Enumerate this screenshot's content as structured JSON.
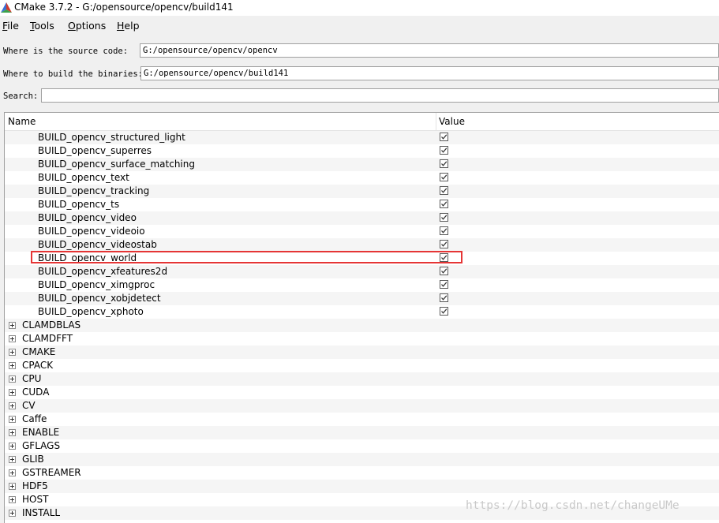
{
  "window": {
    "title": "CMake 3.7.2 - G:/opensource/opencv/build141",
    "icon": "cmake-triangle-icon"
  },
  "menubar": {
    "items": [
      "File",
      "Tools",
      "Options",
      "Help"
    ]
  },
  "paths": {
    "source_label": "Where is the source code:",
    "source_value": "G:/opensource/opencv/opencv",
    "binaries_label": "Where to build the binaries:",
    "binaries_value": "G:/opensource/opencv/build141"
  },
  "search": {
    "label": "Search:",
    "value": ""
  },
  "tree": {
    "columns": {
      "name": "Name",
      "value": "Value"
    },
    "build_entries": [
      {
        "name": "BUILD_opencv_structured_light",
        "checked": true
      },
      {
        "name": "BUILD_opencv_superres",
        "checked": true
      },
      {
        "name": "BUILD_opencv_surface_matching",
        "checked": true
      },
      {
        "name": "BUILD_opencv_text",
        "checked": true
      },
      {
        "name": "BUILD_opencv_tracking",
        "checked": true
      },
      {
        "name": "BUILD_opencv_ts",
        "checked": true
      },
      {
        "name": "BUILD_opencv_video",
        "checked": true
      },
      {
        "name": "BUILD_opencv_videoio",
        "checked": true
      },
      {
        "name": "BUILD_opencv_videostab",
        "checked": true
      },
      {
        "name": "BUILD_opencv_world",
        "checked": true,
        "highlighted": true
      },
      {
        "name": "BUILD_opencv_xfeatures2d",
        "checked": true
      },
      {
        "name": "BUILD_opencv_ximgproc",
        "checked": true
      },
      {
        "name": "BUILD_opencv_xobjdetect",
        "checked": true
      },
      {
        "name": "BUILD_opencv_xphoto",
        "checked": true
      }
    ],
    "groups": [
      "CLAMDBLAS",
      "CLAMDFFT",
      "CMAKE",
      "CPACK",
      "CPU",
      "CUDA",
      "CV",
      "Caffe",
      "ENABLE",
      "GFLAGS",
      "GLIB",
      "GSTREAMER",
      "HDF5",
      "HOST",
      "INSTALL"
    ]
  },
  "colors": {
    "highlight": "#e53535",
    "row_alt": "#f5f5f5"
  },
  "watermark": "https://blog.csdn.net/changeUMe"
}
